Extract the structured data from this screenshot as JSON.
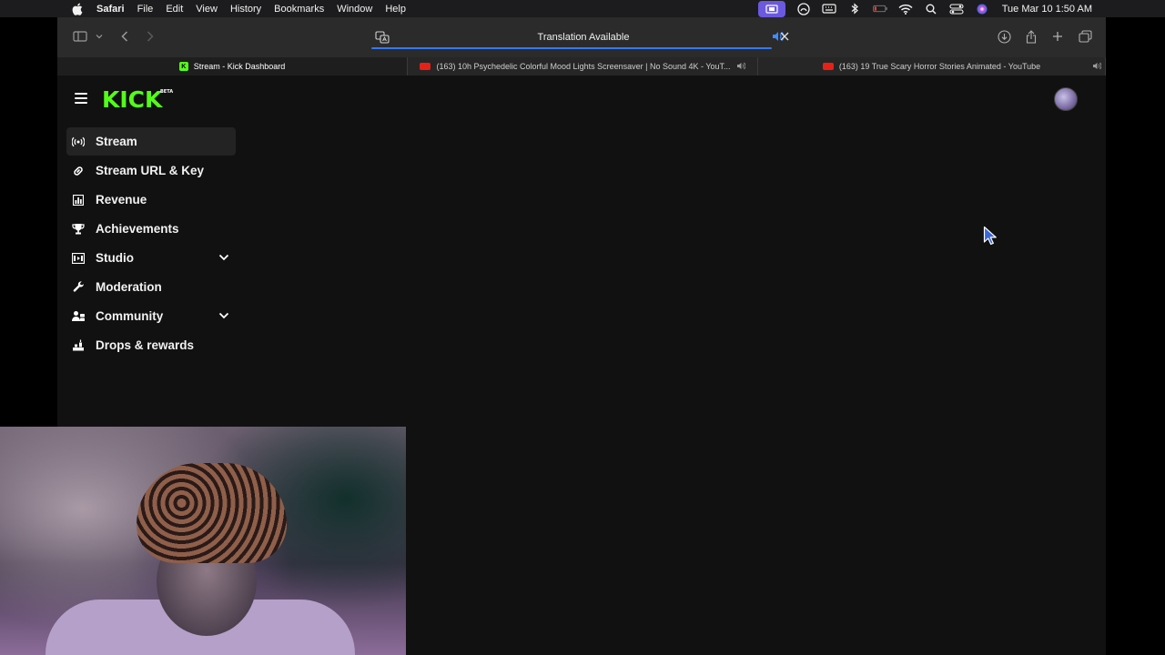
{
  "menubar": {
    "app_name": "Safari",
    "items": [
      "File",
      "Edit",
      "View",
      "History",
      "Bookmarks",
      "Window",
      "Help"
    ],
    "clock": "Tue Mar 10  1:50 AM"
  },
  "toolbar": {
    "address_text": "Translation Available"
  },
  "tabs": [
    {
      "title": "Stream - Kick Dashboard",
      "favicon": "kick",
      "active": true
    },
    {
      "title": "(163) 10h Psychedelic Colorful Mood Lights Screensaver | No Sound 4K - YouT...",
      "favicon": "youtube",
      "active": false
    },
    {
      "title": "(163) 19 True Scary Horror Stories Animated - YouTube",
      "favicon": "youtube",
      "active": false
    }
  ],
  "kick": {
    "logo_text": "KICK",
    "logo_badge": "BETA",
    "accent": "#53fc18",
    "nav": [
      {
        "label": "Stream",
        "icon": "stream-signal-icon",
        "active": true
      },
      {
        "label": "Stream URL & Key",
        "icon": "link-icon"
      },
      {
        "label": "Revenue",
        "icon": "bar-chart-icon"
      },
      {
        "label": "Achievements",
        "icon": "trophy-icon"
      },
      {
        "label": "Studio",
        "icon": "studio-icon",
        "expandable": true
      },
      {
        "label": "Moderation",
        "icon": "wrench-icon"
      },
      {
        "label": "Community",
        "icon": "community-icon",
        "expandable": true
      },
      {
        "label": "Drops & rewards",
        "icon": "drops-icon"
      }
    ]
  }
}
